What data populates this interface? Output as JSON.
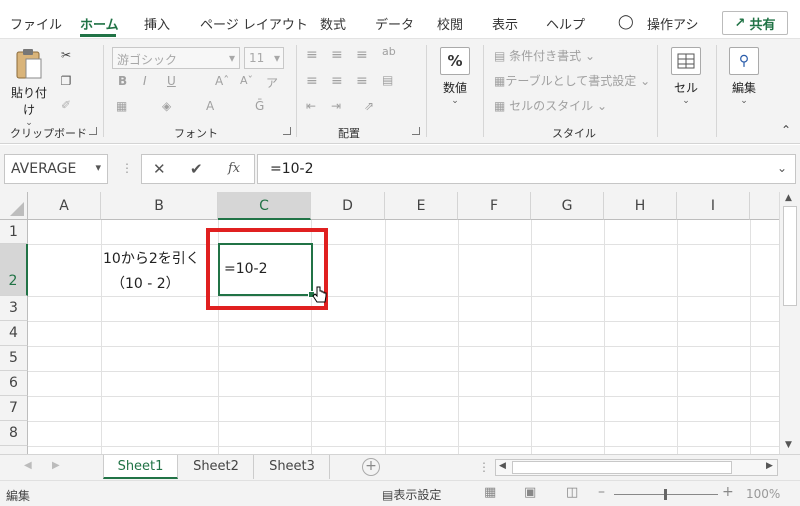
{
  "menu": [
    "ファイル",
    "ホーム",
    "挿入",
    "ページ レイアウト",
    "数式",
    "データ",
    "校閲",
    "表示",
    "ヘルプ",
    "操作アシ"
  ],
  "share_label": "共有",
  "ribbon": {
    "clipboard": {
      "paste": "貼り付け",
      "group": "クリップボード"
    },
    "font": {
      "name": "游ゴシック",
      "size": "11",
      "group": "フォント"
    },
    "alignment": {
      "group": "配置"
    },
    "number": {
      "label": "数値",
      "symbol": "%"
    },
    "styles": {
      "conditional": "条件付き書式",
      "table": "テーブルとして書式設定",
      "cell_style": "セルのスタイル",
      "group": "スタイル"
    },
    "cells": {
      "label": "セル"
    },
    "editing": {
      "label": "編集"
    }
  },
  "formula_bar": {
    "name_box": "AVERAGE",
    "fx": "fx",
    "content": "=10-2"
  },
  "columns": [
    "A",
    "B",
    "C",
    "D",
    "E",
    "F",
    "G",
    "H",
    "I"
  ],
  "rows": [
    "1",
    "2",
    "3",
    "4",
    "5",
    "6",
    "7",
    "8"
  ],
  "cells": {
    "B2_line1": "10から2を引く",
    "B2_line2": "（10 - 2）",
    "C2": "=10-2"
  },
  "highlight_color": "#e02020",
  "sheets": [
    "Sheet1",
    "Sheet2",
    "Sheet3"
  ],
  "status": {
    "mode": "編集",
    "display_settings": "表示設定",
    "zoom": "100%"
  }
}
